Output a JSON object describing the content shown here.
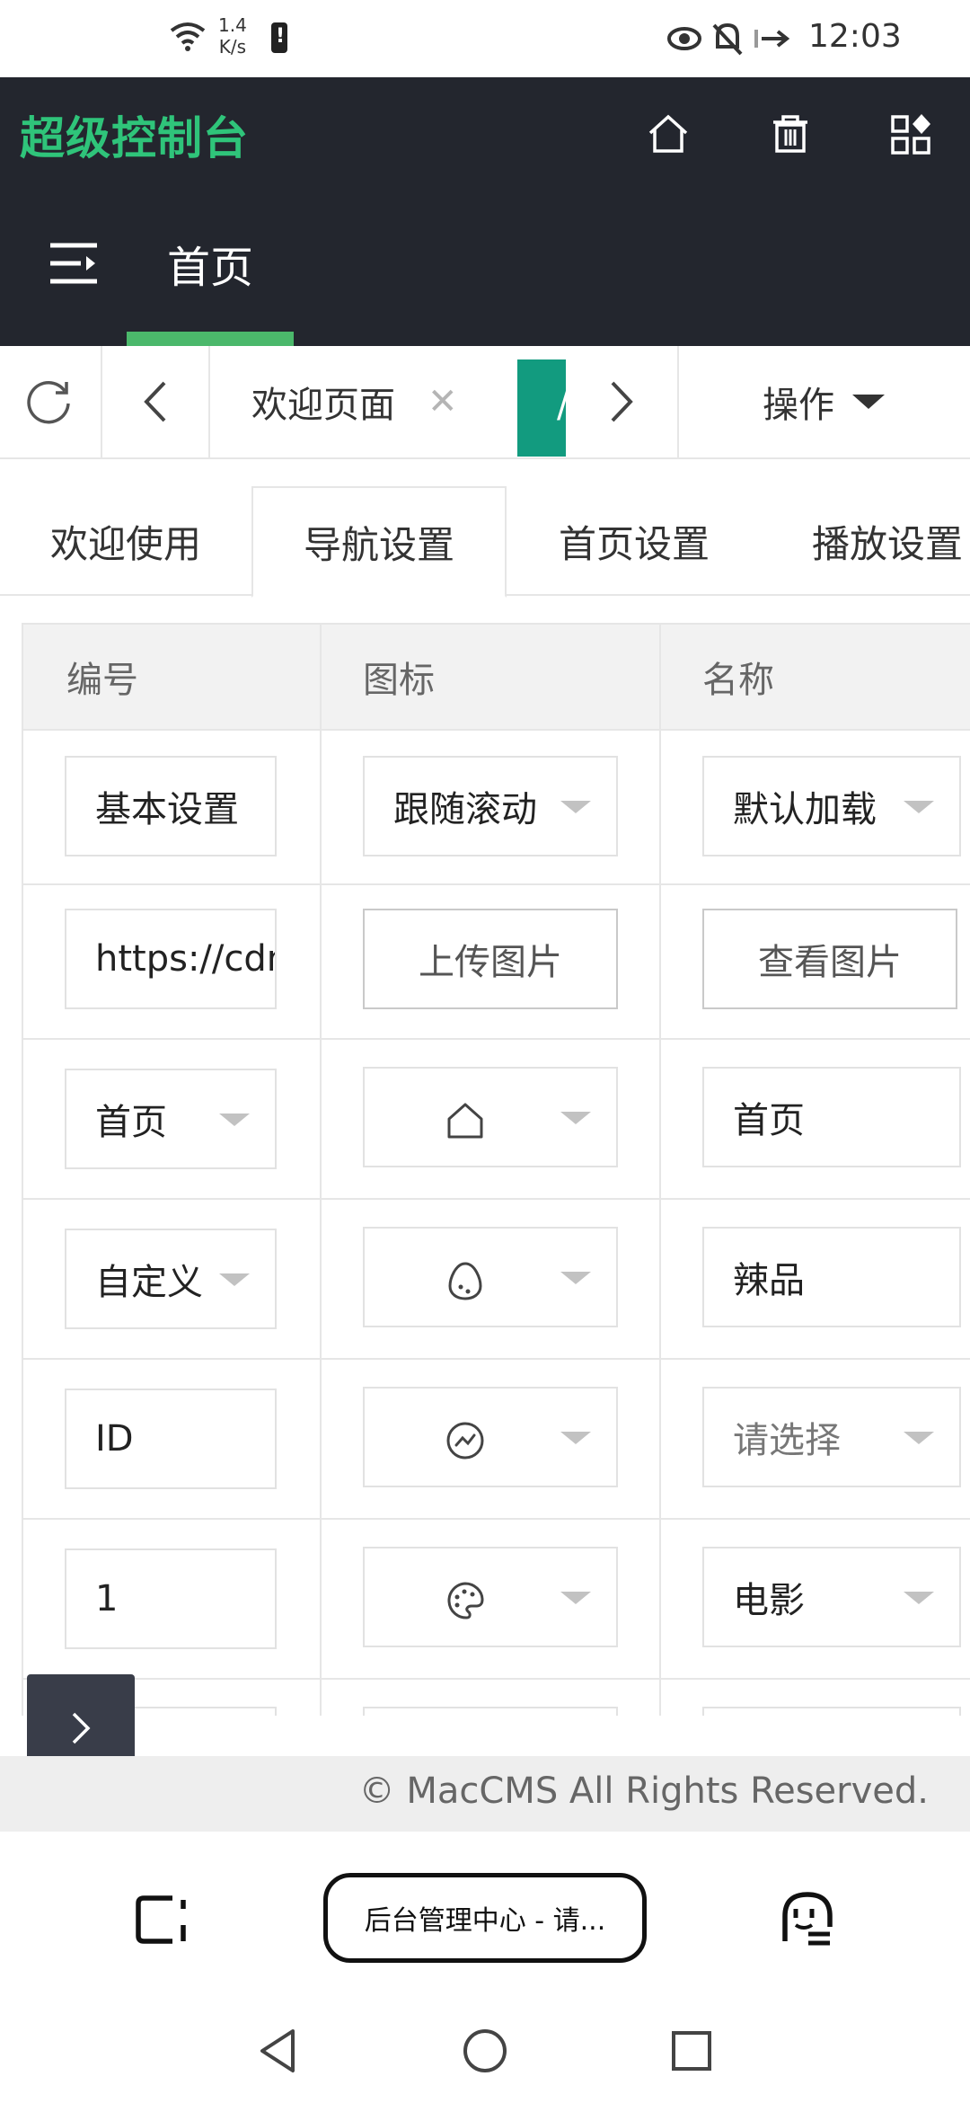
{
  "status_bar": {
    "speed_value": "1.4",
    "speed_unit": "K/s",
    "time": "12:03"
  },
  "header": {
    "brand": "超级控制台",
    "page_title": "首页",
    "icons": [
      "home-icon",
      "trash-icon",
      "grid-icon"
    ]
  },
  "tabstrip": {
    "open_tab_label": "欢迎页面",
    "active_tab_fragment": "/",
    "operate_label": "操作"
  },
  "content_tabs": [
    "欢迎使用",
    "导航设置",
    "首页设置",
    "播放设置"
  ],
  "active_content_tab": "导航设置",
  "table": {
    "columns": [
      "编号",
      "图标",
      "名称"
    ],
    "rows": [
      {
        "col1": "基本设置",
        "col2": "跟随滚动",
        "col3": "默认加载"
      },
      {
        "col1": "https://cdn",
        "col2": "上传图片",
        "col3": "查看图片"
      },
      {
        "col1": "首页",
        "col2_icon": "home-outline-icon",
        "col3": "首页"
      },
      {
        "col1": "自定义",
        "col2_icon": "egg-icon",
        "col3": "辣品"
      },
      {
        "col1": "ID",
        "col2_icon": "trend-circle-icon",
        "col3": "请选择"
      },
      {
        "col1": "1",
        "col2_icon": "palette-icon",
        "col3": "电影"
      }
    ]
  },
  "footer": {
    "copyright": "© MacCMS All Rights Reserved."
  },
  "browser": {
    "url_label": "后台管理中心 - 请..."
  }
}
